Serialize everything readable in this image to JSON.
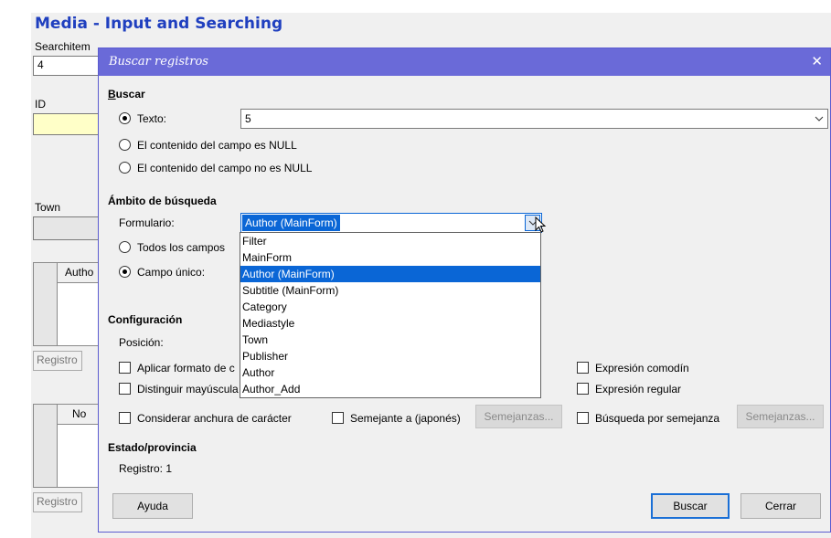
{
  "background_form": {
    "title": "Media - Input and Searching",
    "searchitem_label": "Searchitem",
    "searchitem_value": "4",
    "id_label": "ID",
    "town_label": "Town",
    "grid1_col": "Autho",
    "grid2_col": "No",
    "nav_label": "Registro"
  },
  "dialog": {
    "title": "Buscar registros",
    "buscar": {
      "section": "Buscar",
      "texto_label": "Texto:",
      "texto_value": "5",
      "null_label": "El contenido del campo es NULL",
      "not_null_label": "El contenido del campo no es NULL"
    },
    "ambito": {
      "section": "Ámbito de búsqueda",
      "formulario_label": "Formulario:",
      "formulario_value": "Author (MainForm)",
      "todos_label": "Todos los campos",
      "campo_unico_label": "Campo único:"
    },
    "dropdown_options": [
      "Filter",
      "MainForm",
      "Author (MainForm)",
      "Subtitle (MainForm)",
      "Category",
      "Mediastyle",
      "Town",
      "Publisher",
      "Author",
      "Author_Add"
    ],
    "dropdown_selected_index": 2,
    "config": {
      "section": "Configuración",
      "posicion_label": "Posición:",
      "aplicar_label": "Aplicar formato de c",
      "distinguir_label": "Distinguir mayúscula",
      "anchura_label": "Considerar anchura de carácter",
      "semejante_label": "Semejante a (japonés)",
      "semejanzas_btn1": "Semejanzas...",
      "comodin_label": "Expresión comodín",
      "regular_label": "Expresión regular",
      "busqueda_semejanza_label": "Búsqueda por semejanza",
      "semejanzas_btn2": "Semejanzas..."
    },
    "estado": {
      "section": "Estado/provincia",
      "registro_text": "Registro:  1"
    },
    "buttons": {
      "ayuda": "Ayuda",
      "buscar": "Buscar",
      "cerrar": "Cerrar"
    }
  },
  "colors": {
    "titlebar": "#6a6ad8",
    "form_title": "#1f3fbf",
    "highlight": "#0a66d6",
    "id_field_bg": "#ffffc8"
  }
}
